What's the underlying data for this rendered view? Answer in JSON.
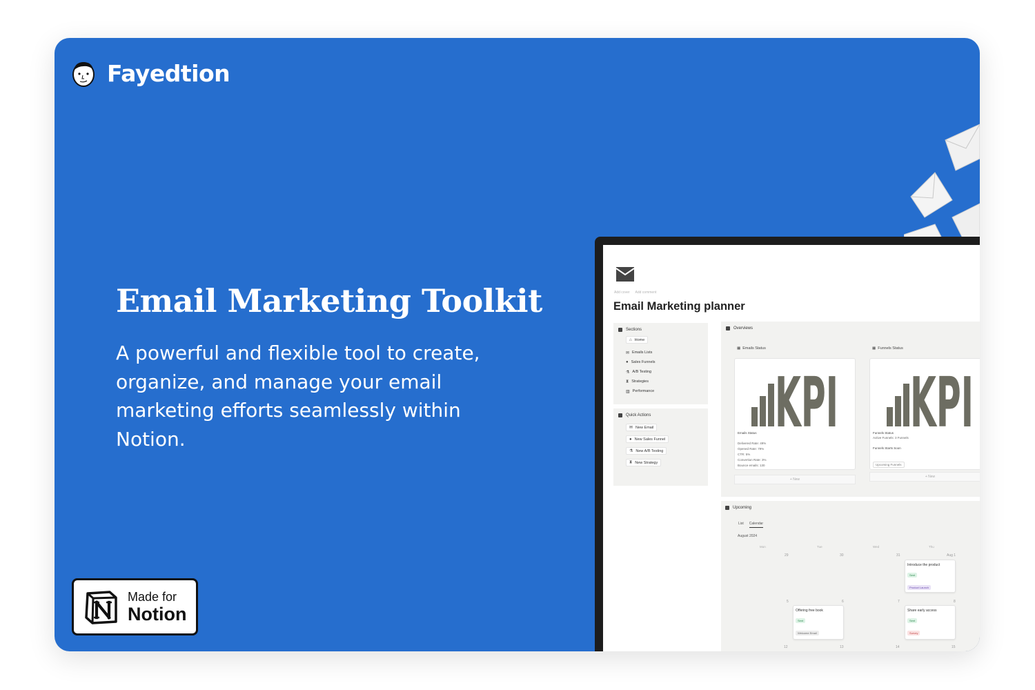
{
  "brand": {
    "name": "Fayedtion",
    "avatar_icon": "face-icon"
  },
  "hero": {
    "title": "Email Marketing Toolkit",
    "subtitle": "A powerful and flexible tool to create, organize, and manage your email marketing efforts seamlessly within Notion."
  },
  "badge": {
    "small": "Made for",
    "big": "Notion",
    "icon": "notion-logo-icon"
  },
  "colors": {
    "background": "#266ece",
    "screen_bezel": "#1d1d1d"
  },
  "notion_page": {
    "title": "Email Marketing planner",
    "add_cover": "Add cover",
    "add_comment": "Add comment",
    "sections": {
      "heading": "Sections",
      "items": [
        "Home",
        "Emails Lists",
        "Sales Funnels",
        "A/B Testing",
        "Strategies",
        "Performance"
      ]
    },
    "quick_actions": {
      "heading": "Quick Actions",
      "items": [
        "New Email",
        "New Sales Funnel",
        "New A/B Testing",
        "New Strategy"
      ]
    },
    "overviews": {
      "heading": "Overviews",
      "emails": {
        "title": "Emails Status",
        "kpi_label": "KPI",
        "status": "Emails Status",
        "lines": [
          "Delivered Rate: 49%",
          "Opened Rate: 79%",
          "CTR: 5%",
          "Convertion Rate: 3%",
          "Bounce emails: 130"
        ],
        "new": "+ New"
      },
      "funnels": {
        "title": "Funnels Status",
        "kpi_label": "KPI",
        "status": "Funnels Status",
        "active": "Active Funnels: 3 Funnels",
        "starts_soon": "Funnels Starts Soon",
        "tag": "Upcoming Funnels",
        "new": "+ New"
      }
    },
    "upcoming": {
      "heading": "Upcoming",
      "tabs": [
        "List",
        "Calendar"
      ],
      "month": "August 2024",
      "weekdays": [
        "Mon",
        "Tue",
        "Wed",
        "Thu"
      ],
      "row1_dates": [
        "29",
        "30",
        "31",
        "Aug 1"
      ],
      "row2_dates": [
        "5",
        "6",
        "7",
        "8"
      ],
      "row3_dates": [
        "12",
        "13",
        "14",
        "15"
      ],
      "events": [
        {
          "title": "Introduce the product",
          "status": "Sent",
          "tag": "Product Launch"
        },
        {
          "title": "Offering free book",
          "status": "Sent",
          "tag": "Welcome Email"
        },
        {
          "title": "Share early access",
          "status": "Sent",
          "tag": "Survey"
        }
      ]
    }
  }
}
